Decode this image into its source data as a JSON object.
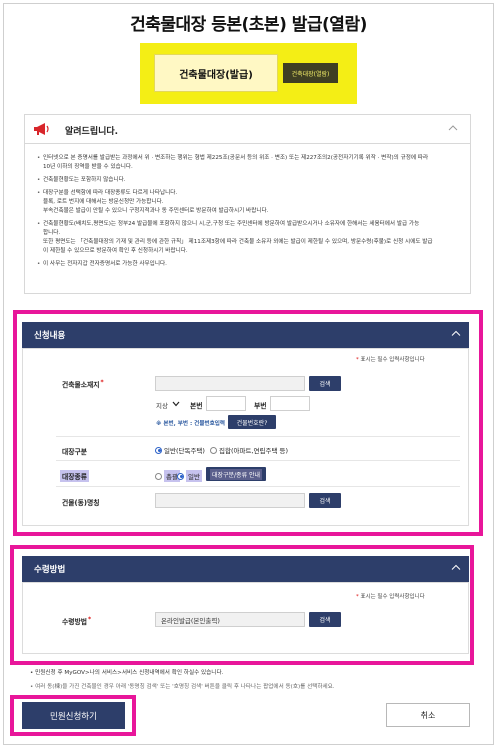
{
  "page": {
    "title": "건축물대장 등본(초본) 발급(열람)"
  },
  "tabs": {
    "main": "건축물대장(발급)",
    "sub": "건축대장(열람)"
  },
  "notice": {
    "title": "알려드립니다.",
    "items": [
      "인터넷으로 본 증명서를 발급받는 과정에서 위 · 변조하는 행위는 형법 제225조(공문서 등의 위조 · 변조) 또는 제227조의2(공전자기기록 위작 · 변작)의 규정에 따라\n10년 이하의 징역을 받을 수 있습니다.",
      "건축물현황도는 포함하지 않습니다.",
      "대장구분을 선택함에 따라 대장종류도 다르게 나타납니다.\n블록, 로트 번지에 대해서는 방문신청만 가능합니다.\n부속건축물은 발급이 안될 수 있으니 구청지적과나 동 주민센터로 방문하여 발급하시기 바랍니다.",
      "건축물현황도(배치도,평면도)는 정부24 발급물에 포함하지 않으니 시,군,구청 또는 주민센터에 방문하여 발급받으시거나 소유자에 한해서는 세움터에서 발급 가능\n합니다.\n또한 평면도는 「건축물대장의 기재 및 관리 등에 관한 규칙」 제11조제3항에 따라 건축물 소유자 외에는 발급이 제한될 수 있으며, 방문수령(후불)로 신청 시에도 발급\n이 제한될 수 있으므로 방문하여 확인 후 신청하시기 바랍니다.",
      "이 사무는 전자지갑 전자증명서로 가능한 사무입니다."
    ]
  },
  "application": {
    "header": "신청내용",
    "required_note": "표시는 필수 입력사항입니다",
    "address_label": "건축물소재지",
    "address_value": "",
    "search_label": "검색",
    "land_type": "지상",
    "main_no_label": "본번",
    "sub_no_label": "부번",
    "num_note": "※ 본번, 부번 : 건물번호입력",
    "bldg_no_btn": "건물번호란?",
    "register_type_label": "대장구분",
    "register_type_options": [
      "일반(단독주택)",
      "집합(아파트,연립주택 등)"
    ],
    "register_kind_label": "대장종류",
    "register_kind_options": [
      "총괄",
      "일반"
    ],
    "register_kind_btn": "대장구분/종류 안내",
    "building_name_label": "건물(동)명칭",
    "building_name_value": ""
  },
  "receipt": {
    "header": "수령방법",
    "required_note": "표시는 필수 입력사항입니다",
    "method_label": "수령방법",
    "method_value": "온라인발급(본인출력)",
    "search_label": "검색"
  },
  "footnotes": [
    "민원신청 후 MyGOV>나의 서비스>서비스 신청내역에서 확인 하실수 있습니다.",
    "여러 동(棟)을 가진 건축물인 경우 아래 '동명칭 검색' 또는 '호명칭 검색' 버튼을 클릭 후 나타나는 팝업에서 동(호)를 선택하세요."
  ],
  "actions": {
    "apply": "민원신청하기",
    "cancel": "취소"
  },
  "colors": {
    "navy": "#2d3e6a",
    "highlight_yellow": "#f4ee15",
    "annotation_pink": "#e8169a"
  }
}
